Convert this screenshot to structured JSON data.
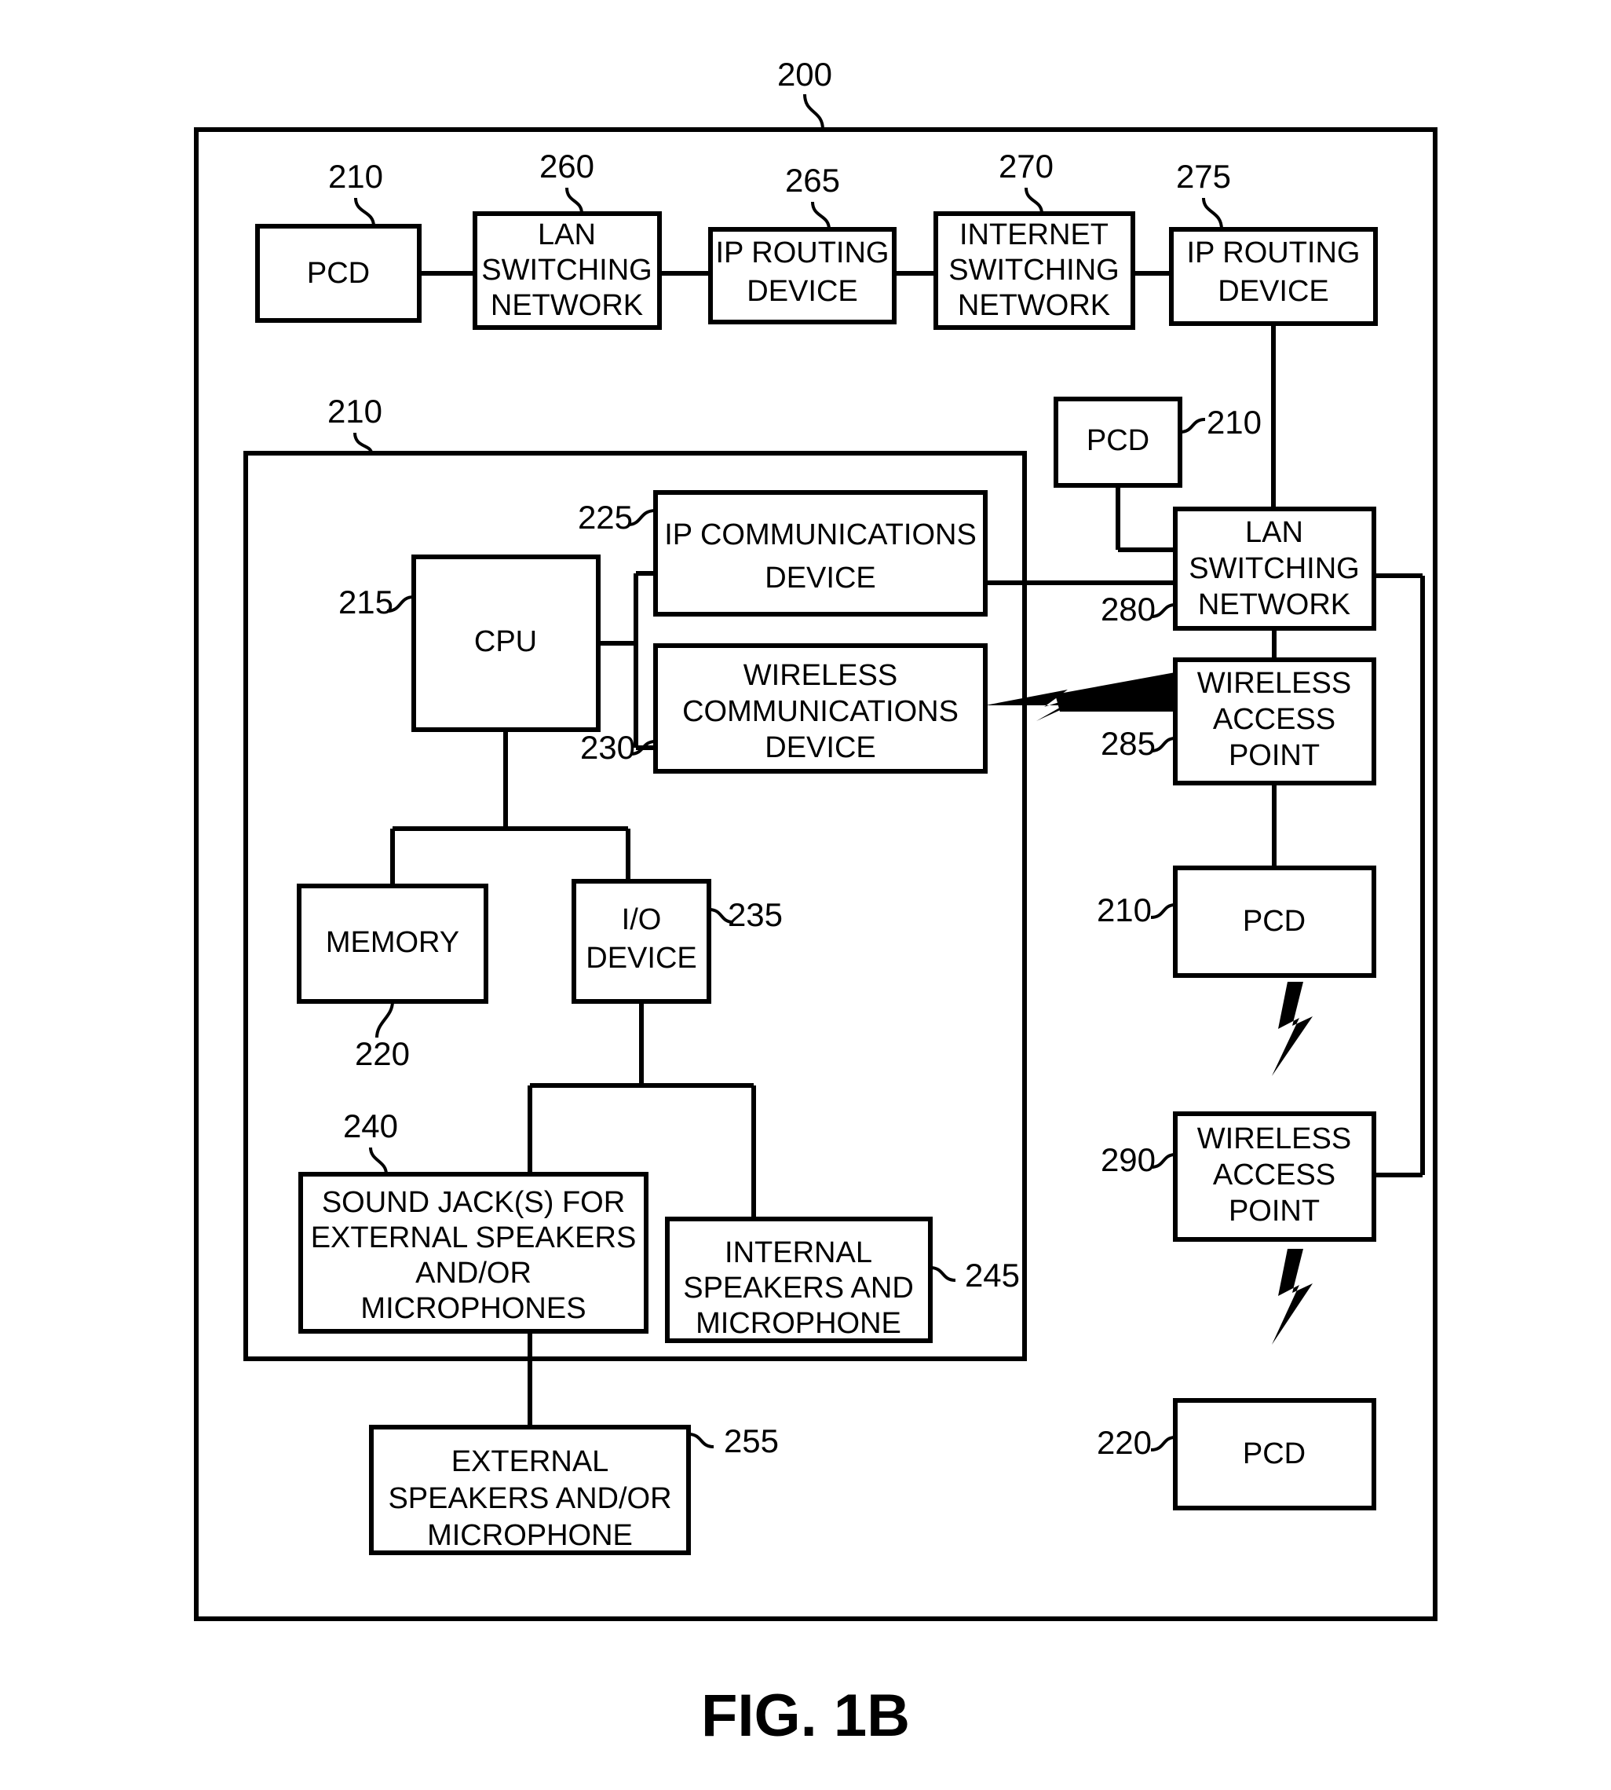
{
  "figure": {
    "caption": "FIG. 1B",
    "outer_ref": "200"
  },
  "top_row": {
    "pcd": {
      "label": "PCD",
      "ref": "210"
    },
    "lan_switching_network": {
      "line1": "LAN",
      "line2": "SWITCHING",
      "line3": "NETWORK",
      "ref": "260"
    },
    "ip_routing_device_1": {
      "line1": "IP ROUTING",
      "line2": "DEVICE",
      "ref": "265"
    },
    "internet_switching_network": {
      "line1": "INTERNET",
      "line2": "SWITCHING",
      "line3": "NETWORK",
      "ref": "270"
    },
    "ip_routing_device_2": {
      "line1": "IP ROUTING",
      "line2": "DEVICE",
      "ref": "275"
    }
  },
  "pcd_detail": {
    "container_ref": "210",
    "cpu": {
      "label": "CPU",
      "ref": "215"
    },
    "ip_communications_device": {
      "line1": "IP COMMUNICATIONS",
      "line2": "DEVICE",
      "ref": "225"
    },
    "wireless_communications_device": {
      "line1": "WIRELESS",
      "line2": "COMMUNICATIONS",
      "line3": "DEVICE",
      "ref": "230"
    },
    "memory": {
      "label": "MEMORY",
      "ref": "220"
    },
    "io_device": {
      "line1": "I/O",
      "line2": "DEVICE",
      "ref": "235"
    },
    "sound_jacks": {
      "line1": "SOUND JACK(S) FOR",
      "line2": "EXTERNAL SPEAKERS",
      "line3": "AND/OR",
      "line4": "MICROPHONES",
      "ref": "240"
    },
    "internal_speakers": {
      "line1": "INTERNAL",
      "line2": "SPEAKERS AND",
      "line3": "MICROPHONE",
      "ref": "245"
    }
  },
  "external_speakers": {
    "line1": "EXTERNAL",
    "line2": "SPEAKERS AND/OR",
    "line3": "MICROPHONE",
    "ref": "255"
  },
  "right_column": {
    "pcd_top": {
      "label": "PCD",
      "ref": "210"
    },
    "lan_switching_network": {
      "line1": "LAN",
      "line2": "SWITCHING",
      "line3": "NETWORK",
      "ref": "280"
    },
    "wireless_access_point_1": {
      "line1": "WIRELESS",
      "line2": "ACCESS",
      "line3": "POINT",
      "ref": "285"
    },
    "pcd_middle": {
      "label": "PCD",
      "ref": "210"
    },
    "wireless_access_point_2": {
      "line1": "WIRELESS",
      "line2": "ACCESS",
      "line3": "POINT",
      "ref": "290"
    },
    "pcd_bottom": {
      "label": "PCD",
      "ref": "220"
    }
  }
}
